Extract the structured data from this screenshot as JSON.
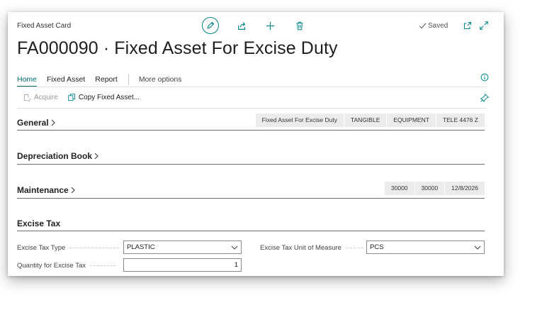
{
  "header": {
    "page_type": "Fixed Asset Card",
    "title": "FA000090 · Fixed Asset For Excise Duty",
    "saved_label": "Saved",
    "icons": [
      "edit-icon",
      "share-icon",
      "add-icon",
      "delete-icon",
      "open-new-window-icon",
      "expand-icon"
    ]
  },
  "nav": {
    "tabs": [
      "Home",
      "Fixed Asset",
      "Report"
    ],
    "more": "More options"
  },
  "actions": {
    "acquire": "Acquire",
    "copy": "Copy Fixed Asset..."
  },
  "sections": {
    "general": {
      "title": "General",
      "pills": [
        "Fixed Asset For Excise Duty",
        "TANGIBLE",
        "EQUIPMENT",
        "TELE 4476 Z"
      ]
    },
    "depreciation": {
      "title": "Depreciation Book"
    },
    "maintenance": {
      "title": "Maintenance",
      "pills": [
        "30000",
        "30000",
        "12/8/2026"
      ]
    },
    "excise": {
      "title": "Excise Tax",
      "fields": {
        "tax_type_label": "Excise Tax Type",
        "tax_type_value": "PLASTIC",
        "uom_label": "Excise Tax Unit of Measure",
        "uom_value": "PCS",
        "qty_label": "Quantity for Excise Tax",
        "qty_value": "1"
      }
    }
  },
  "colors": {
    "accent": "#008489",
    "nav_active": "#006f74"
  }
}
